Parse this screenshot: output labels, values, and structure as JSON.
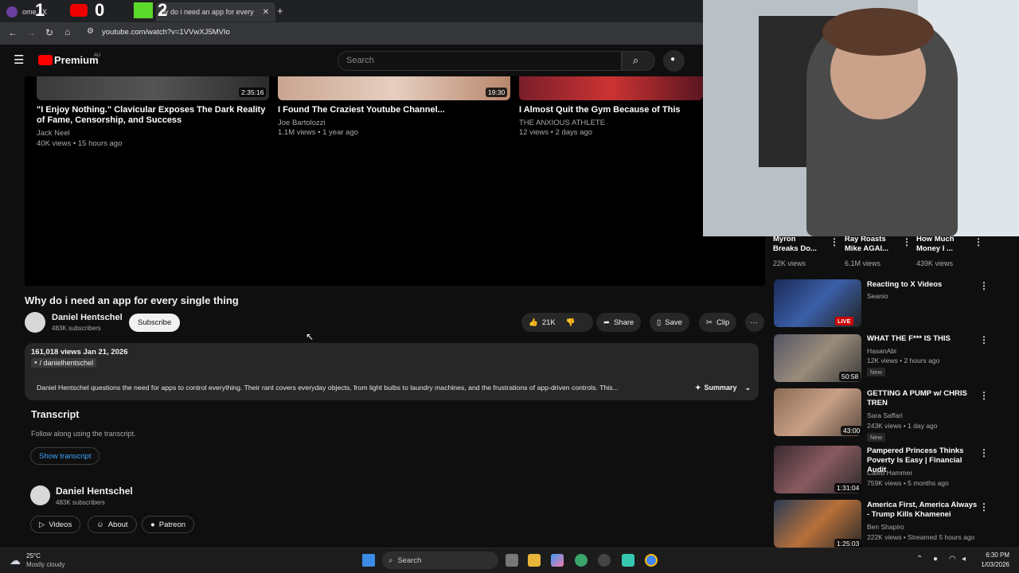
{
  "browser": {
    "tabs": [
      "ome / X",
      "hy do i need an app for every"
    ],
    "url": "youtube.com/watch?v=1VVwXJ5MVIo",
    "overlay_counters": [
      "1",
      "0",
      "2"
    ]
  },
  "header": {
    "logo": "Premium",
    "region": "AU",
    "search_placeholder": "Search"
  },
  "recommended": [
    {
      "title": "\"I Enjoy Nothing.\" Clavicular Exposes The Dark Reality of Fame, Censorship, and Success",
      "channel": "Jack Neel",
      "meta": "40K views • 15 hours ago",
      "duration": "2:35:16"
    },
    {
      "title": "I Found The Craziest Youtube Channel...",
      "channel": "Joe Bartolozzi",
      "meta": "1.1M views • 1 year ago",
      "duration": "19:30"
    },
    {
      "title": "I Almost Quit the Gym Because of This",
      "channel": "THE ANXIOUS ATHLETE",
      "meta": "12 views • 2 days ago",
      "duration": ""
    }
  ],
  "video": {
    "title": "Why do i need an app for every single thing",
    "channel": "Daniel Hentschel",
    "subscribers": "483K subscribers",
    "subscribe": "Subscribe",
    "likes": "21K",
    "share": "Share",
    "save": "Save",
    "clip": "Clip",
    "stats": "161,018 views  Jan 21, 2026",
    "handle": "/ danielhentschel",
    "description": "Daniel Hentschel questions the need for apps to control everything. Their rant covers everyday objects, from light bulbs to laundry machines, and the frustrations of app-driven controls. This...",
    "summary": "Summary"
  },
  "transcript": {
    "heading": "Transcript",
    "subtext": "Follow along using the transcript.",
    "button": "Show transcript"
  },
  "channel_card": {
    "name": "Daniel Hentschel",
    "subscribers": "483K subscribers",
    "videos": "Videos",
    "about": "About",
    "patreon": "Patreon"
  },
  "shorts": [
    {
      "title": "Myron Breaks Do...",
      "views": "22K views"
    },
    {
      "title": "Ray Roasts Mike AGAI...",
      "views": "6.1M views"
    },
    {
      "title": "How Much Money I ...",
      "views": "439K views"
    }
  ],
  "sidebar": [
    {
      "title": "Reacting to X Videos",
      "channel": "Seanio",
      "meta": "",
      "badge": "LIVE",
      "duration": "",
      "is_new": false
    },
    {
      "title": "WHAT THE F*** IS THIS",
      "channel": "HasanAbi",
      "meta": "12K views • 2 hours ago",
      "badge": "",
      "duration": "50:58",
      "is_new": true
    },
    {
      "title": "GETTING A PUMP w/ CHRIS TREN",
      "channel": "Sara Saffari",
      "meta": "243K views • 1 day ago",
      "badge": "",
      "duration": "43:00",
      "is_new": true
    },
    {
      "title": "Pampered Princess Thinks Poverty Is Easy | Financial Audit",
      "channel": "Caleb Hammer",
      "meta": "759K views • 5 months ago",
      "badge": "",
      "duration": "1:31:04",
      "is_new": false
    },
    {
      "title": "America First, America Always - Trump Kills Khamenei",
      "channel": "Ben Shapiro",
      "meta": "222K views • Streamed 5 hours ago",
      "badge": "",
      "duration": "1:25:03",
      "is_new": true
    }
  ],
  "new_label": "New",
  "taskbar": {
    "weather_temp": "25°C",
    "weather_desc": "Mostly cloudy",
    "search": "Search",
    "time": "6:30 PM",
    "date": "1/03/2026"
  }
}
